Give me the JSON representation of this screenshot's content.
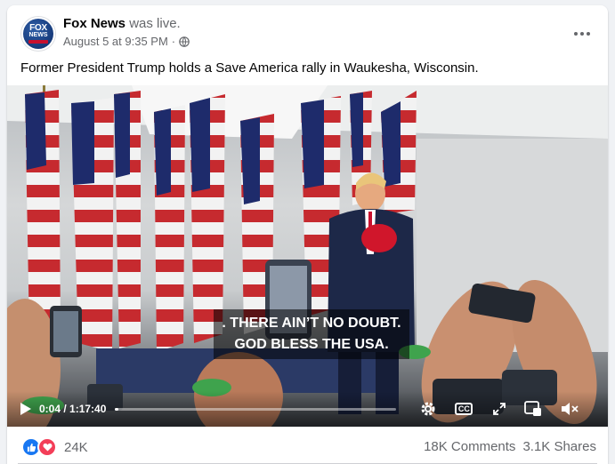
{
  "post": {
    "page_name": "Fox News",
    "status": "was live.",
    "timestamp": "August 5 at 9:35 PM",
    "separator": "·",
    "text": "Former President Trump holds a Save America rally in Waukesha, Wisconsin."
  },
  "logo": {
    "line1": "FOX",
    "line2": "NEWS"
  },
  "video": {
    "caption_line1": ". THERE AIN’T NO DOUBT.",
    "caption_line2": "GOD BLESS THE USA.",
    "time": "0:04 / 1:17:40",
    "progress": 0.0009
  },
  "footer": {
    "reaction_count": "24K",
    "comments": "18K Comments",
    "shares": "3.1K Shares"
  },
  "colors": {
    "like": "#1877f2",
    "love": "#f33e58",
    "muted_text": "#65676b"
  }
}
